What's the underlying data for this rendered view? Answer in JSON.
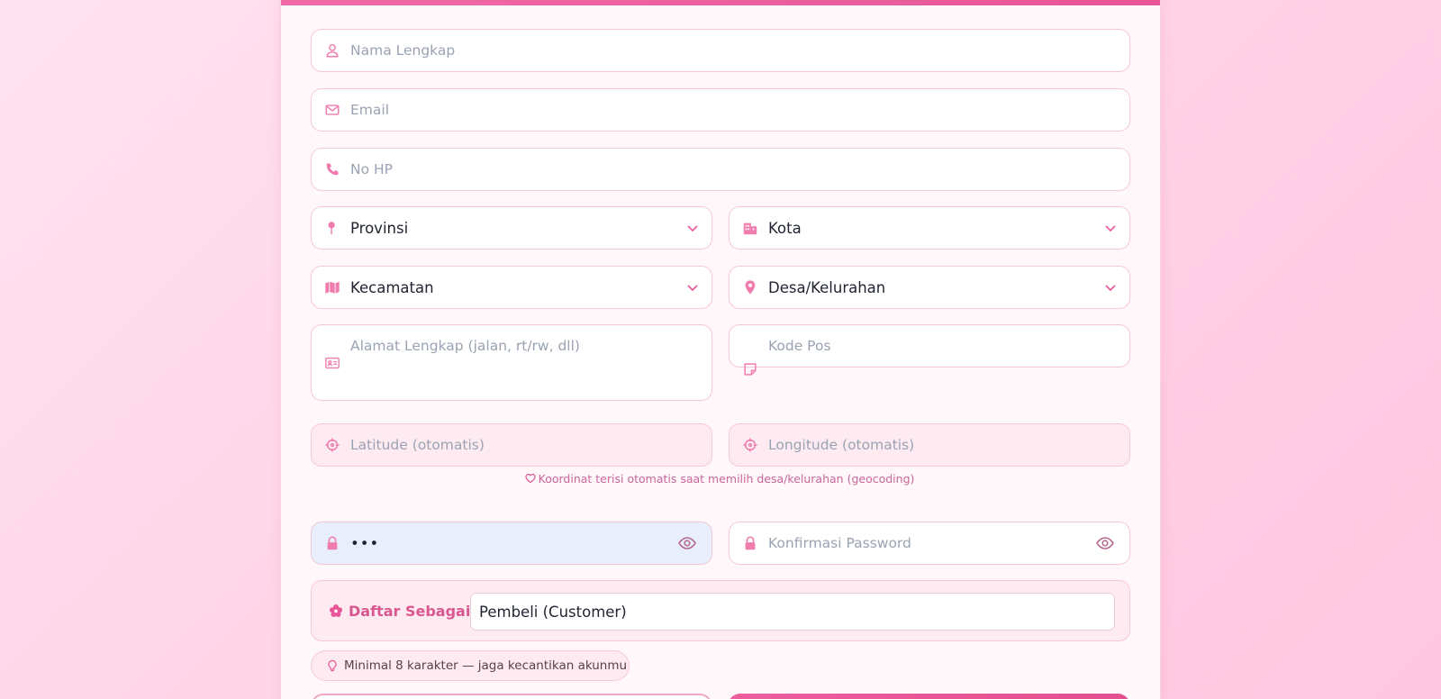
{
  "colors": {
    "accent": "#e85598",
    "field_border": "#f6c9da",
    "placeholder": "#9aa3b2"
  },
  "form": {
    "name": {
      "placeholder": "Nama Lengkap",
      "icon": "user-icon"
    },
    "email": {
      "placeholder": "Email",
      "icon": "envelope-icon"
    },
    "phone": {
      "placeholder": "No HP",
      "icon": "phone-icon"
    },
    "province": {
      "value": "Provinsi",
      "icon": "pin-icon"
    },
    "city": {
      "value": "Kota",
      "icon": "city-icon"
    },
    "district": {
      "value": "Kecamatan",
      "icon": "map-icon"
    },
    "village": {
      "value": "Desa/Kelurahan",
      "icon": "location-pin-icon"
    },
    "address": {
      "placeholder": "Alamat Lengkap (jalan, rt/rw, dll)",
      "icon": "address-card-icon"
    },
    "postal": {
      "placeholder": "Kode Pos",
      "icon": "sticky-note-icon"
    },
    "latitude": {
      "placeholder": "Latitude (otomatis)",
      "icon": "crosshair-icon"
    },
    "longitude": {
      "placeholder": "Longitude (otomatis)",
      "icon": "crosshair-icon"
    },
    "coord_note": "Koordinat terisi otomatis saat memilih desa/kelurahan (geocoding)",
    "password": {
      "value": "•••",
      "icon": "lock-icon"
    },
    "confirm_password": {
      "placeholder": "Konfirmasi Password",
      "icon": "lock-icon"
    },
    "role": {
      "label": "Daftar Sebagai",
      "value": "Pembeli (Customer)"
    },
    "password_hint": "Minimal 8 karakter — jaga kecantikan akunmu"
  }
}
